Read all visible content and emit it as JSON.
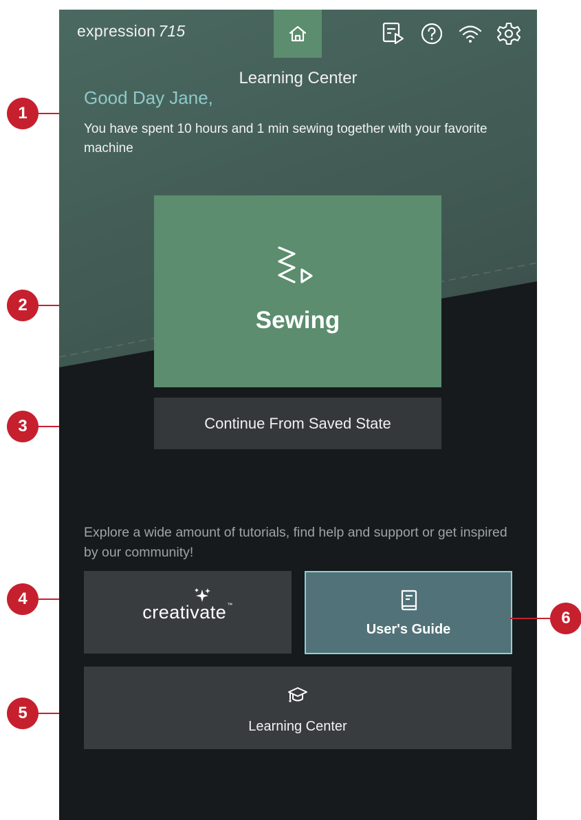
{
  "header": {
    "brand_name": "expression",
    "brand_model": "715",
    "icons": [
      "home-icon",
      "video-tutorial-icon",
      "help-icon",
      "wifi-icon",
      "settings-icon"
    ]
  },
  "screen_title": "Learning Center",
  "greeting": "Good Day Jane,",
  "sewing_time": "You have spent 10 hours and 1 min sewing together with your favorite machine",
  "sewing_button": {
    "label": "Sewing",
    "icon": "sewing-start-icon"
  },
  "continue_button": {
    "label": "Continue From Saved State"
  },
  "explore_text": "Explore a wide amount of tutorials, find help and support or get inspired by our community!",
  "tiles": {
    "creativate": {
      "logo_text": "creativate",
      "trademark": "™"
    },
    "users_guide": {
      "label": "User's Guide",
      "icon": "book-icon"
    },
    "learning_center": {
      "label": "Learning Center",
      "icon": "graduation-cap-icon"
    }
  },
  "callouts": [
    "1",
    "2",
    "3",
    "4",
    "5",
    "6"
  ],
  "colors": {
    "accent_green": "#5b8d6e",
    "greeting_teal": "#8ec9c9",
    "guide_tile": "#517278",
    "callout_red": "#c6202e"
  }
}
